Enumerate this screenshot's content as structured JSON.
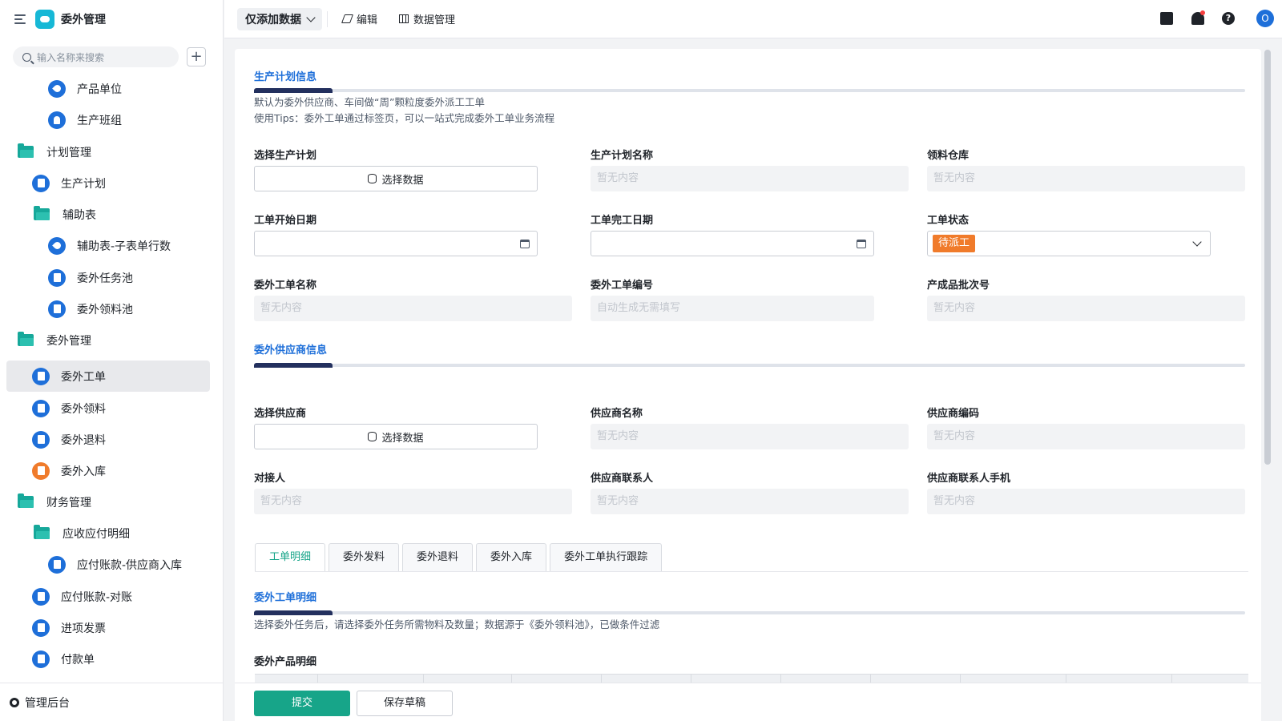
{
  "app": {
    "title": "委外管理"
  },
  "sidebar": {
    "search_placeholder": "输入名称来搜索",
    "add_symbol": "+",
    "items": [
      {
        "label": "产品单位"
      },
      {
        "label": "生产班组"
      },
      {
        "label": "计划管理"
      },
      {
        "label": "生产计划"
      },
      {
        "label": "辅助表"
      },
      {
        "label": "辅助表-子表单行数"
      },
      {
        "label": "委外任务池"
      },
      {
        "label": "委外领料池"
      },
      {
        "label": "委外管理"
      },
      {
        "label": "委外工单"
      },
      {
        "label": "委外领料"
      },
      {
        "label": "委外退料"
      },
      {
        "label": "委外入库"
      },
      {
        "label": "财务管理"
      },
      {
        "label": "应收应付明细"
      },
      {
        "label": "应付账款-供应商入库"
      },
      {
        "label": "应付账款-对账"
      },
      {
        "label": "进项发票"
      },
      {
        "label": "付款单"
      }
    ],
    "footer_label": "管理后台"
  },
  "toolbar": {
    "view_dropdown": "仅添加数据",
    "edit_label": "编辑",
    "data_manage_label": "数据管理",
    "avatar_letter": "O",
    "help_symbol": "?"
  },
  "form": {
    "section1": {
      "title": "生产计划信息",
      "desc_line1": "默认为委外供应商、车间做“周”颗粒度委外派工工单",
      "desc_line2": "使用Tips：委外工单通过标签页，可以一站式完成委外工单业务流程"
    },
    "fields": {
      "select_plan": {
        "label": "选择生产计划",
        "button": "选择数据"
      },
      "plan_name": {
        "label": "生产计划名称",
        "placeholder": "暂无内容"
      },
      "warehouse": {
        "label": "领料仓库",
        "placeholder": "暂无内容"
      },
      "start_date": {
        "label": "工单开始日期"
      },
      "end_date": {
        "label": "工单完工日期"
      },
      "status": {
        "label": "工单状态",
        "value": "待派工",
        "color": "#f07b2b"
      },
      "order_name": {
        "label": "委外工单名称",
        "placeholder": "暂无内容"
      },
      "order_no": {
        "label": "委外工单编号",
        "placeholder": "自动生成无需填写"
      },
      "batch_no": {
        "label": "产成品批次号",
        "placeholder": "暂无内容"
      }
    },
    "section2": {
      "title": "委外供应商信息"
    },
    "supplier": {
      "select_supplier": {
        "label": "选择供应商",
        "button": "选择数据"
      },
      "supplier_name": {
        "label": "供应商名称",
        "placeholder": "暂无内容"
      },
      "supplier_code": {
        "label": "供应商编码",
        "placeholder": "暂无内容"
      },
      "contact_person": {
        "label": "对接人",
        "placeholder": "暂无内容"
      },
      "supplier_contact": {
        "label": "供应商联系人",
        "placeholder": "暂无内容"
      },
      "supplier_phone": {
        "label": "供应商联系人手机",
        "placeholder": "暂无内容"
      }
    },
    "tabs": [
      "工单明细",
      "委外发料",
      "委外退料",
      "委外入库",
      "委外工单执行跟踪"
    ],
    "section3": {
      "title": "委外工单明细",
      "desc": "选择委外任务后，请选择委外任务所需物料及数量；数据源于《委外领料池》，已做条件过滤"
    },
    "product_detail_label": "委外产品明细",
    "submit_label": "提交",
    "draft_label": "保存草稿"
  },
  "colors": {
    "accent": "#17a589",
    "brand_blue": "#1e6fd9",
    "section_title": "#1e6fd9"
  }
}
